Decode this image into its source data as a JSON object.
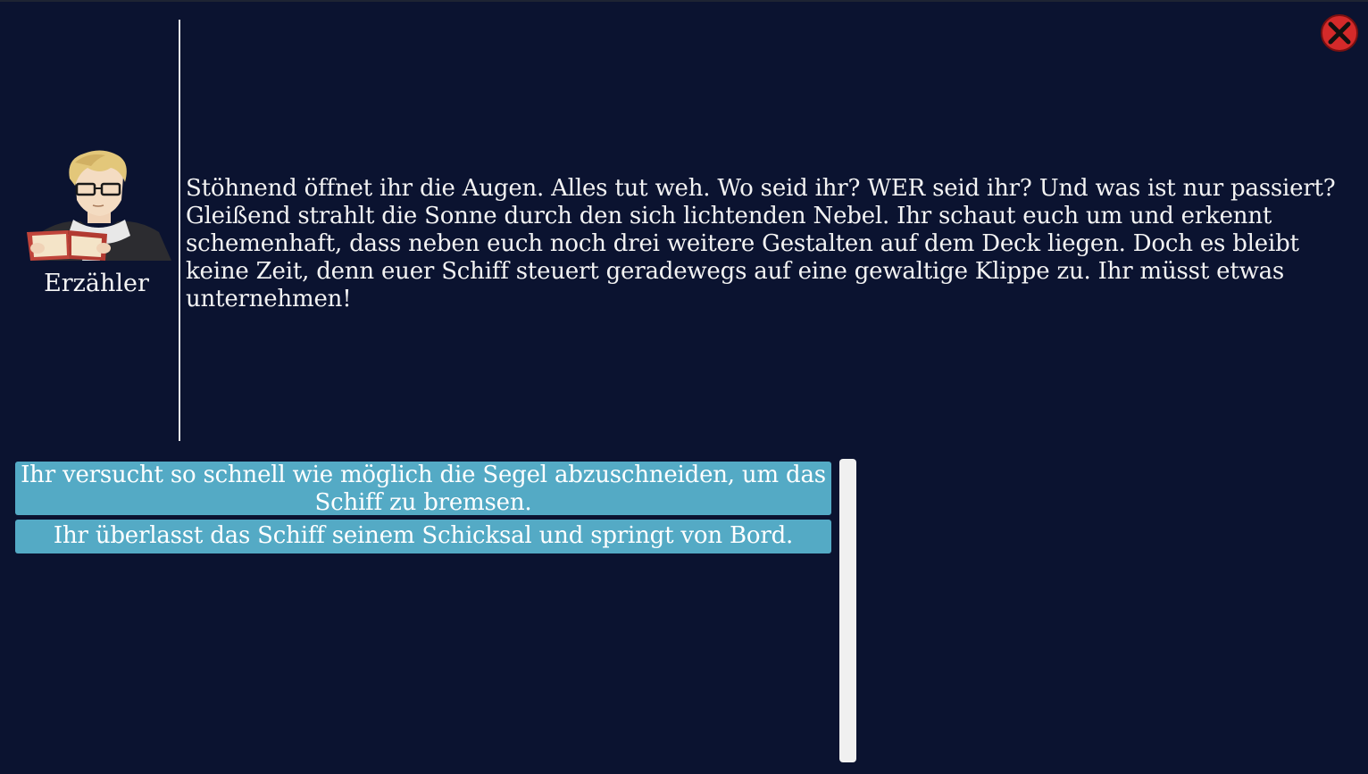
{
  "speaker": {
    "name": "Erzähler",
    "portrait_icon": "narrator-portrait-icon"
  },
  "dialogue": {
    "text": "Stöhnend öffnet ihr die Augen. Alles tut weh. Wo seid ihr? WER seid ihr? Und was ist nur passiert?\nGleißend strahlt die Sonne durch den sich lichtenden Nebel. Ihr schaut euch um und erkennt schemenhaft, dass neben euch noch drei weitere Gestalten auf dem Deck liegen. Doch es bleibt keine Zeit, denn euer Schiff steuert geradewegs auf eine gewaltige Klippe zu. Ihr müsst etwas unternehmen!"
  },
  "choices": [
    {
      "label": "Ihr versucht so schnell wie möglich die Segel abzuschneiden, um das Schiff zu bremsen."
    },
    {
      "label": "Ihr überlasst das Schiff seinem Schicksal und springt von Bord."
    }
  ],
  "close_button": {
    "icon": "close-icon"
  },
  "colors": {
    "background": "#0b1330",
    "choice_background": "#54aac5",
    "close_red": "#d42a2a"
  }
}
